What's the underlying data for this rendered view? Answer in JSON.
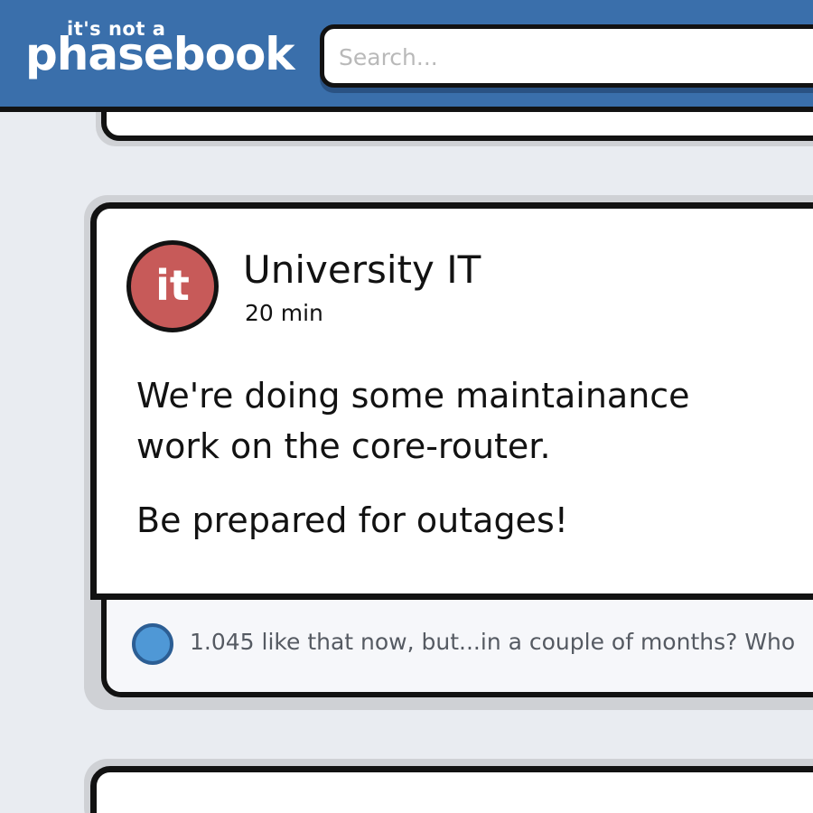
{
  "header": {
    "logo_small": "it's not a",
    "logo_big": "phasebook"
  },
  "search": {
    "placeholder": "Search..."
  },
  "post": {
    "avatar_text": "it",
    "author": "University IT",
    "time": "20 min",
    "body_lines": [
      "We're doing some maintainance work on the core-router.",
      "Be prepared for outages!"
    ]
  },
  "comment": {
    "text": "1.045 like that now, but...in a couple of months? Who"
  },
  "colors": {
    "header_bg": "#3a6fab",
    "avatar_bg": "#c75a59",
    "comment_dot": "#4f98d6",
    "page_bg": "#e9ecf1"
  }
}
